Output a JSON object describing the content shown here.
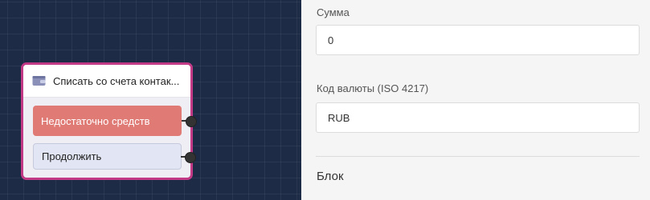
{
  "node": {
    "title": "Списать со счета контак...",
    "icon": "wallet-icon",
    "ports": {
      "insufficient_label": "Недостаточно средств",
      "continue_label": "Продолжить"
    }
  },
  "panel": {
    "amount": {
      "label": "Сумма",
      "value": "0"
    },
    "currency": {
      "label": "Код валюты (ISO 4217)",
      "value": "RUB"
    },
    "section_title": "Блок"
  },
  "colors": {
    "canvas_bg": "#1d2b47",
    "node_border": "#c23a86",
    "danger": "#e07a75",
    "neutral": "#e2e5f3"
  }
}
